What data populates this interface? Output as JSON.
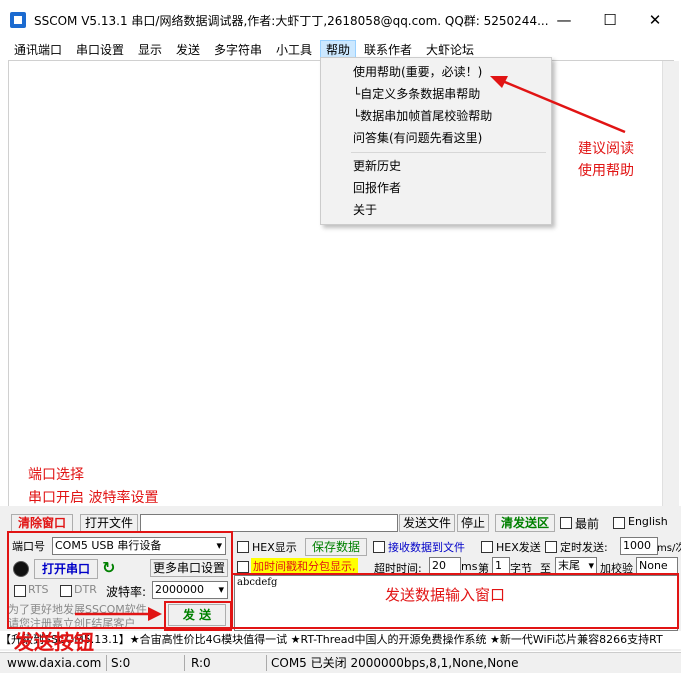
{
  "window": {
    "title": "SSCOM V5.13.1 串口/网络数据调试器,作者:大虾丁丁,2618058@qq.com. QQ群: 5250244...",
    "minimize": "—",
    "maximize": "☐",
    "close": "✕"
  },
  "menu": [
    "通讯端口",
    "串口设置",
    "显示",
    "发送",
    "多字符串",
    "小工具",
    "帮助",
    "联系作者",
    "大虾论坛"
  ],
  "help_menu": [
    "使用帮助(重要，必读！)",
    "└自定义多条数据串帮助",
    "└数据串加帧首尾校验帮助",
    "问答集(有问题先看这里)",
    "更新历史",
    "回报作者",
    "关于"
  ],
  "annotations": {
    "help": [
      "建议阅读",
      "使用帮助"
    ],
    "port": [
      "端口选择",
      "串口开启  波特率设置"
    ],
    "send_input": "发送数据输入窗口",
    "send_button": "发送按钮"
  },
  "panel": {
    "clear_btn": "清除窗口",
    "open_file_btn": "打开文件",
    "send_file_btn": "发送文件",
    "stop_btn": "停止",
    "clear_send_btn": "清发送区",
    "topmost": "最前",
    "english": "English",
    "port_label": "端口号",
    "port_value": "COM5 USB 串行设备",
    "more_settings": "更多串口设置",
    "open_port_btn": "打开串口",
    "rts": "RTS",
    "dtr": "DTR",
    "baud_label": "波特率:",
    "baud_value": "2000000",
    "hex_display": "HEX显示",
    "save_data": "保存数据",
    "recv_to_file": "接收数据到文件",
    "hex_send": "HEX发送",
    "timed_send": "定时发送:",
    "timed_value": "1000",
    "timed_unit": "ms/次",
    "timestamp": "加时间戳和分包显示,",
    "timeout_label": "超时时间:",
    "timeout_value": "20",
    "ms": "ms",
    "byte_from": "第",
    "byte_from_value": "1",
    "byte_unit": "字节",
    "to": "至",
    "to_value": "末尾",
    "checksum": "加校验",
    "checksum_value": "None",
    "send_text": "abcdefg",
    "promo1": "为了更好地发展SSCOM软件",
    "promo2": "请您注册嘉立创F结尾客户",
    "send_btn": "发 送"
  },
  "ticker": "【升级到SSCOM5.13.1】★合宙高性价比4G模块值得一试 ★RT-Thread中国人的开源免费操作系统 ★新一代WiFi芯片兼容8266支持RT",
  "status": {
    "url": "www.daxia.com",
    "s": "S:0",
    "r": "R:0",
    "port_state": "COM5 已关闭  2000000bps,8,1,None,None"
  },
  "colors": {
    "annotation_red": "#e11414",
    "accent_blue": "#1c6bd0",
    "menu_active": "#cce8ff"
  }
}
